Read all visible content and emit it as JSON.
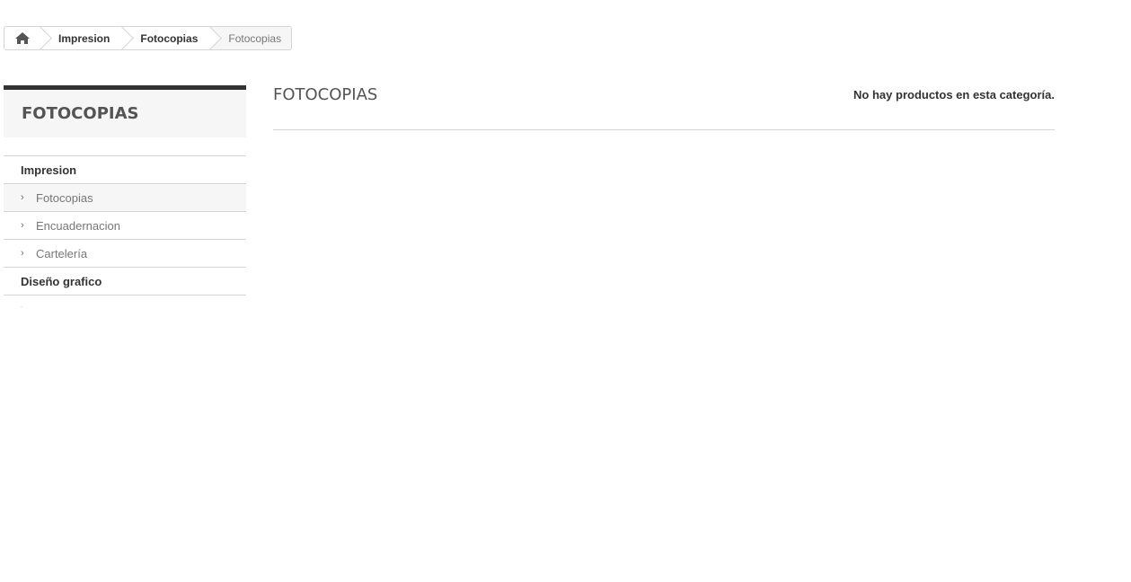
{
  "breadcrumb": {
    "home_icon": "home-icon",
    "items": [
      {
        "label": "Impresion"
      },
      {
        "label": "Fotocopias"
      },
      {
        "label": "Fotocopias"
      }
    ]
  },
  "sidebar": {
    "title": "FOTOCOPIAS",
    "categories": [
      {
        "label": "Impresion",
        "children": [
          {
            "label": "Fotocopias",
            "selected": true
          },
          {
            "label": "Encuadernacion"
          },
          {
            "label": "Cartelería"
          }
        ]
      },
      {
        "label": "Diseño grafico",
        "children": []
      }
    ]
  },
  "main": {
    "title": "FOTOCOPIAS",
    "notice": "No hay productos en esta categoría."
  },
  "colors": {
    "border": "#d6d4d4",
    "dark_bar": "#333333",
    "title_bg": "#f6f6f6"
  }
}
